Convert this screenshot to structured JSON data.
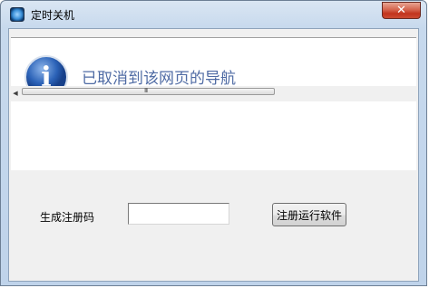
{
  "window": {
    "title": "定时关机",
    "close_symbol": "✕"
  },
  "webview": {
    "message": "已取消到该网页的导航",
    "info_icon": "info-icon",
    "scrollbar_left_arrow": "◀",
    "scrollbar_grip": "III"
  },
  "registration": {
    "label": "生成注册码",
    "input_value": "",
    "button_label": "注册运行软件"
  }
}
